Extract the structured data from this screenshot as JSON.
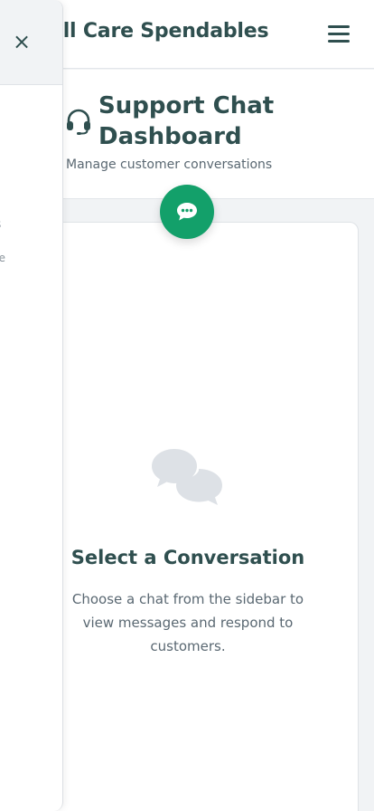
{
  "header": {
    "brand": "ell Care Spendables",
    "menu_icon": "hamburger-menu-icon"
  },
  "dashboard": {
    "title": "Support Chat Dashboard",
    "subtitle": "Manage customer conversations",
    "title_icon": "headset-icon"
  },
  "fab": {
    "icon": "chat-bubble-icon",
    "color": "#13a06a"
  },
  "empty_state": {
    "icon": "conversation-bubbles-icon",
    "title": "Select a Conversation",
    "text": "Choose a chat from the sidebar to view messages and respond to customers."
  },
  "sidebar": {
    "close_label": "×",
    "fragment_1": "s",
    "fragment_2": "re"
  },
  "colors": {
    "accent": "#13a06a",
    "text_dark": "#2f4f4f",
    "text_muted": "#5a6872",
    "background": "#f1f3f5"
  }
}
